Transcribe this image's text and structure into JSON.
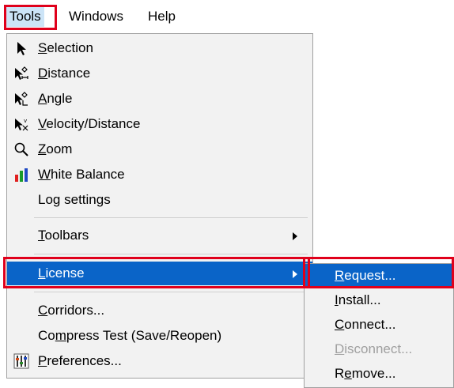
{
  "menubar": {
    "tools": "Tools",
    "windows": "Windows",
    "help": "Help"
  },
  "tools_menu": {
    "selection": {
      "pre": "",
      "u": "S",
      "post": "election",
      "icon": "arrow-cursor-icon"
    },
    "distance": {
      "pre": "",
      "u": "D",
      "post": "istance",
      "icon": "distance-cursor-icon"
    },
    "angle": {
      "pre": "",
      "u": "A",
      "post": "ngle",
      "icon": "angle-cursor-icon"
    },
    "velocity": {
      "pre": "",
      "u": "V",
      "post": "elocity/Distance",
      "icon": "velocity-cursor-icon"
    },
    "zoom": {
      "pre": "",
      "u": "Z",
      "post": "oom",
      "icon": "magnifier-icon"
    },
    "white_balance": {
      "pre": "",
      "u": "W",
      "post": "hite Balance",
      "icon": "bar-graph-icon"
    },
    "log_settings": {
      "pre": "Lo",
      "u": "g",
      "post": " settings"
    },
    "toolbars": {
      "pre": "",
      "u": "T",
      "post": "oolbars"
    },
    "license": {
      "pre": "",
      "u": "L",
      "post": "icense"
    },
    "corridors": {
      "pre": "",
      "u": "C",
      "post": "orridors..."
    },
    "compress": {
      "pre": "Co",
      "u": "m",
      "post": "press Test (Save/Reopen)"
    },
    "preferences": {
      "pre": "",
      "u": "P",
      "post": "references...",
      "icon": "preferences-icon"
    }
  },
  "license_submenu": {
    "request": {
      "pre": "",
      "u": "R",
      "post": "equest..."
    },
    "install": {
      "pre": "",
      "u": "I",
      "post": "nstall..."
    },
    "connect": {
      "pre": "",
      "u": "C",
      "post": "onnect..."
    },
    "disconnect": {
      "pre": "",
      "u": "D",
      "post": "isconnect..."
    },
    "remove": {
      "pre": "R",
      "u": "e",
      "post": "move..."
    }
  },
  "colors": {
    "highlight": "#0a64c8",
    "annotation_red": "#e0001b",
    "menu_bg": "#f2f2f2",
    "disabled_text": "#a0a0a0"
  }
}
